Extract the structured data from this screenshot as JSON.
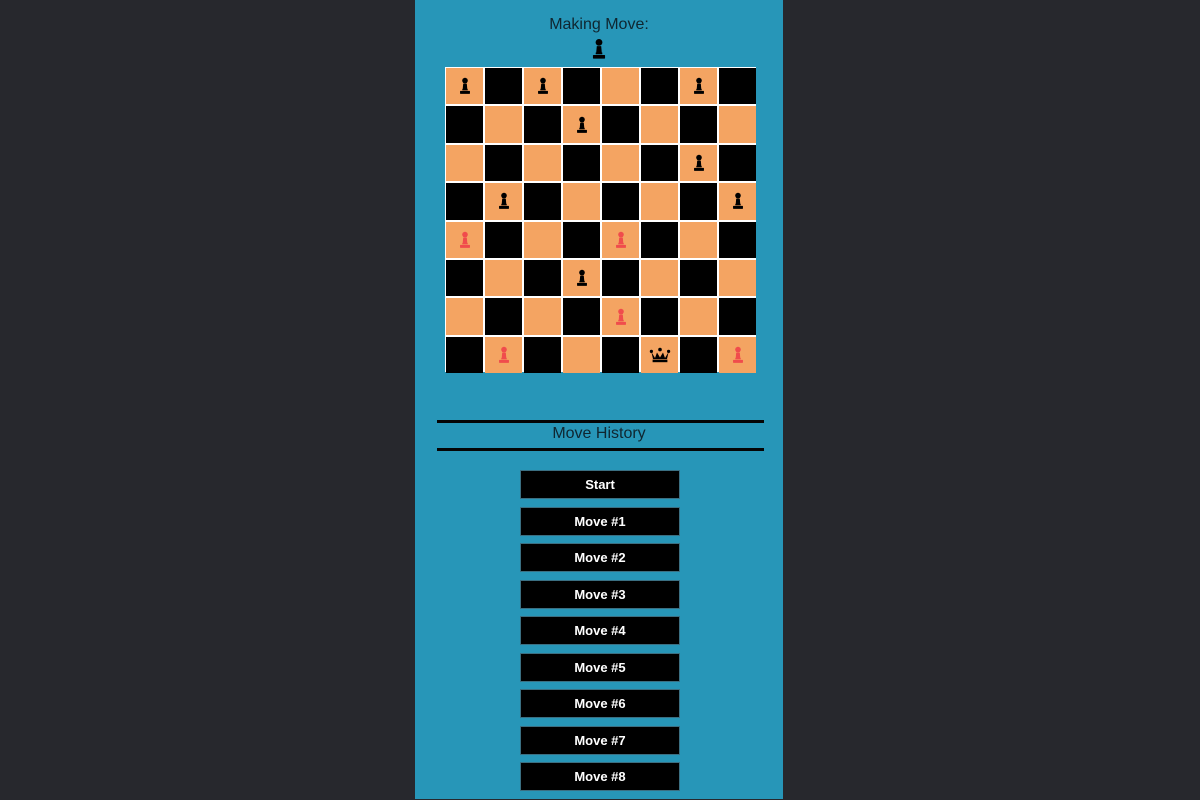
{
  "header": {
    "making_move_label": "Making Move:",
    "current_player_piece": "pawn-black"
  },
  "colors": {
    "background": "#27282d",
    "panel": "#2796b8",
    "light_square": "#f4a462",
    "dark_square": "#000000",
    "black_piece": "#000000",
    "red_piece": "#f04c4c",
    "button_bg": "#000000",
    "button_text": "#ffffff"
  },
  "board": {
    "rows": [
      [
        "pawn-black",
        null,
        "pawn-black",
        null,
        null,
        null,
        "pawn-black",
        null
      ],
      [
        null,
        null,
        null,
        "pawn-black",
        null,
        null,
        null,
        null
      ],
      [
        null,
        null,
        null,
        null,
        null,
        null,
        "pawn-black",
        null
      ],
      [
        null,
        "pawn-black",
        null,
        null,
        null,
        null,
        null,
        "pawn-black"
      ],
      [
        "pawn-red",
        null,
        null,
        null,
        "pawn-red",
        null,
        null,
        null
      ],
      [
        null,
        null,
        null,
        "pawn-black",
        null,
        null,
        null,
        null
      ],
      [
        null,
        null,
        null,
        null,
        "pawn-red",
        null,
        null,
        null
      ],
      [
        null,
        "pawn-red",
        null,
        null,
        null,
        "king-black",
        null,
        "pawn-red"
      ]
    ]
  },
  "history": {
    "title": "Move History",
    "items": [
      "Start",
      "Move #1",
      "Move #2",
      "Move #3",
      "Move #4",
      "Move #5",
      "Move #6",
      "Move #7",
      "Move #8"
    ]
  }
}
